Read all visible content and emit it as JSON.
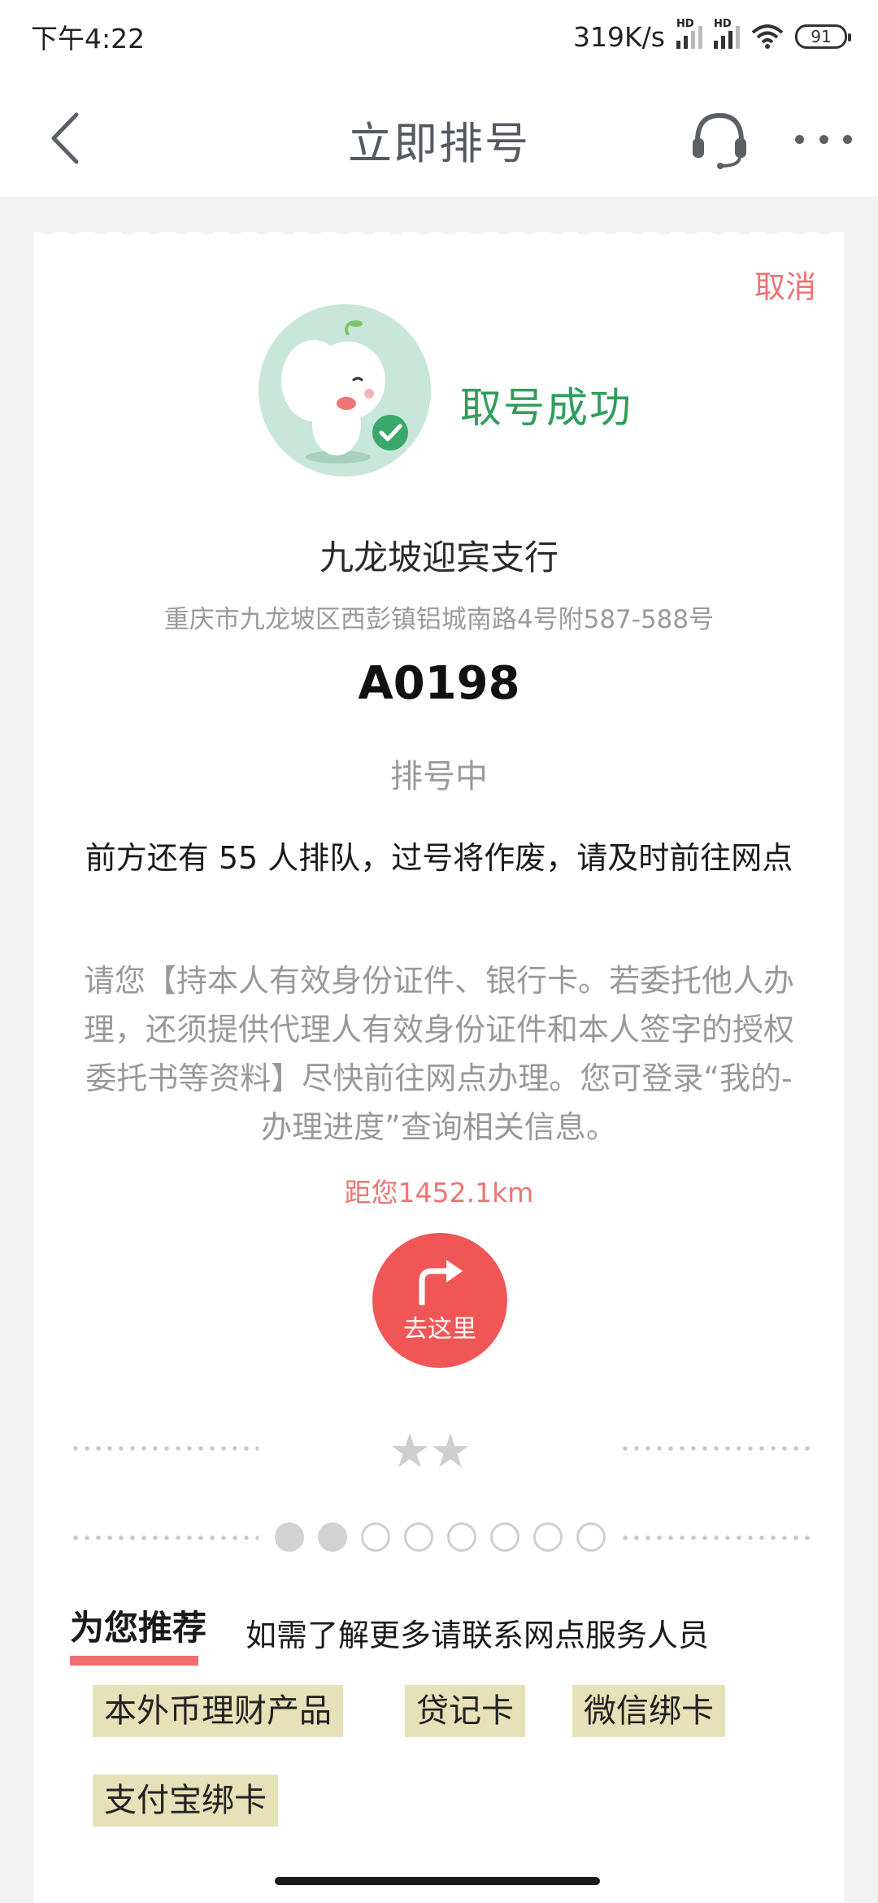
{
  "status_bar": {
    "time": "下午4:22",
    "network_speed": "319K/s",
    "hd_label": "HD",
    "battery": "91"
  },
  "nav": {
    "title": "立即排号"
  },
  "ticket": {
    "cancel_label": "取消",
    "success_text": "取号成功",
    "branch_name": "九龙坡迎宾支行",
    "branch_address": "重庆市九龙坡区西彭镇铝城南路4号附587-588号",
    "queue_number": "A0198",
    "queue_status": "排号中",
    "ahead_notice": "前方还有 55 人排队，过号将作废，请及时前往网点",
    "instructions": "请您【持本人有效身份证件、银行卡。若委托他人办理，还须提供代理人有效身份证件和本人签字的授权委托书等资料】尽快前往网点办理。您可登录“我的-办理进度”查询相关信息。",
    "distance": "距您1452.1km",
    "go_label": "去这里",
    "stars": "★★"
  },
  "pager": {
    "total": 8,
    "active": 2
  },
  "recommend": {
    "title": "为您推荐",
    "hint": "如需了解更多请联系网点服务人员",
    "tags": [
      "本外币理财产品",
      "贷记卡",
      "微信绑卡",
      "支付宝绑卡"
    ]
  },
  "colors": {
    "accent_red": "#ef7474",
    "success_green": "#2f9e5b",
    "button_red": "#f15656",
    "tag_bg": "#e6e1b8"
  },
  "icons": [
    "back-arrow-icon",
    "headset-icon",
    "more-icon",
    "mascot-icon",
    "check-icon",
    "turn-right-arrow-icon",
    "star-icon"
  ]
}
